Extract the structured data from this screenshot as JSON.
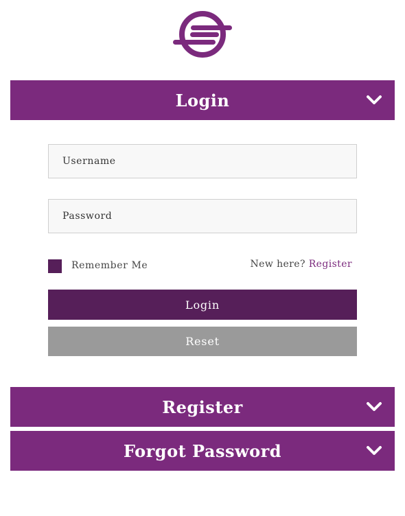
{
  "brand": {
    "logo_icon": "circle-stripes-logo-icon",
    "accent_color": "#7b2a7d",
    "dark_accent_color": "#561f59"
  },
  "login_panel": {
    "title": "Login",
    "chevron_icon": "chevron-down-icon",
    "username_placeholder": "Username",
    "password_placeholder": "Password",
    "remember_label": "Remember Me",
    "new_here_text": "New here?",
    "register_link": "Register",
    "login_button": "Login",
    "reset_button": "Reset"
  },
  "register_panel": {
    "title": "Register",
    "chevron_icon": "chevron-down-icon"
  },
  "forgot_panel": {
    "title": "Forgot Password",
    "chevron_icon": "chevron-down-icon"
  }
}
